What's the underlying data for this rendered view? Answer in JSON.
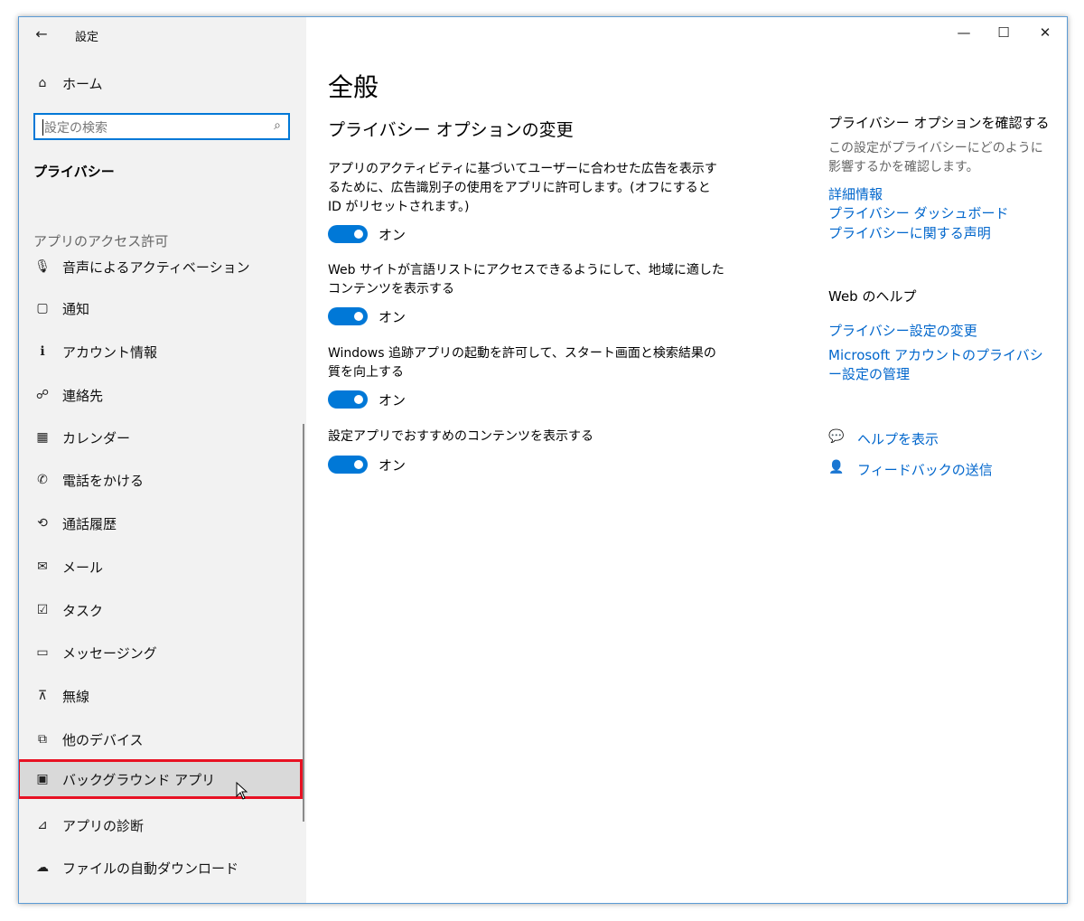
{
  "window": {
    "title": "設定",
    "minimize": "—",
    "maximize": "☐",
    "close": "✕"
  },
  "sidebar": {
    "back_icon": "←",
    "home": {
      "icon": "⌂",
      "label": "ホーム"
    },
    "search": {
      "placeholder": "設定の検索",
      "icon": "⌕"
    },
    "category": "プライバシー",
    "section_header": "アプリのアクセス許可",
    "items": [
      {
        "icon": "🎙",
        "label": "音声によるアクティベーション"
      },
      {
        "icon": "▢",
        "label": "通知"
      },
      {
        "icon": "ℹ",
        "label": "アカウント情報"
      },
      {
        "icon": "☍",
        "label": "連絡先"
      },
      {
        "icon": "▦",
        "label": "カレンダー"
      },
      {
        "icon": "✆",
        "label": "電話をかける"
      },
      {
        "icon": "⟲",
        "label": "通話履歴"
      },
      {
        "icon": "✉",
        "label": "メール"
      },
      {
        "icon": "☑",
        "label": "タスク"
      },
      {
        "icon": "▭",
        "label": "メッセージング"
      },
      {
        "icon": "⊼",
        "label": "無線"
      },
      {
        "icon": "⧉",
        "label": "他のデバイス"
      },
      {
        "icon": "▣",
        "label": "バックグラウンド アプリ"
      },
      {
        "icon": "⊿",
        "label": "アプリの診断"
      },
      {
        "icon": "☁",
        "label": "ファイルの自動ダウンロード"
      }
    ]
  },
  "main": {
    "title": "全般",
    "section_title": "プライバシー オプションの変更",
    "settings": [
      {
        "description": "アプリのアクティビティに基づいてユーザーに合わせた広告を表示するために、広告識別子の使用をアプリに許可します。(オフにすると ID がリセットされます。)",
        "state": "オン"
      },
      {
        "description": "Web サイトが言語リストにアクセスできるようにして、地域に適したコンテンツを表示する",
        "state": "オン"
      },
      {
        "description": "Windows 追跡アプリの起動を許可して、スタート画面と検索結果の質を向上する",
        "state": "オン"
      },
      {
        "description": "設定アプリでおすすめのコンテンツを表示する",
        "state": "オン"
      }
    ],
    "side": {
      "options_heading": "プライバシー オプションを確認する",
      "options_desc": "この設定がプライバシーにどのように影響するかを確認します。",
      "links": [
        "詳細情報",
        "プライバシー ダッシュボード",
        "プライバシーに関する声明"
      ],
      "web_help_heading": "Web のヘルプ",
      "help_links": [
        "プライバシー設定の変更",
        "Microsoft アカウントのプライバシー設定の管理"
      ],
      "get_help": "ヘルプを表示",
      "feedback": "フィードバックの送信"
    }
  },
  "colors": {
    "accent": "#0078d7",
    "link": "#0066cc",
    "highlight_border": "#e81123"
  }
}
